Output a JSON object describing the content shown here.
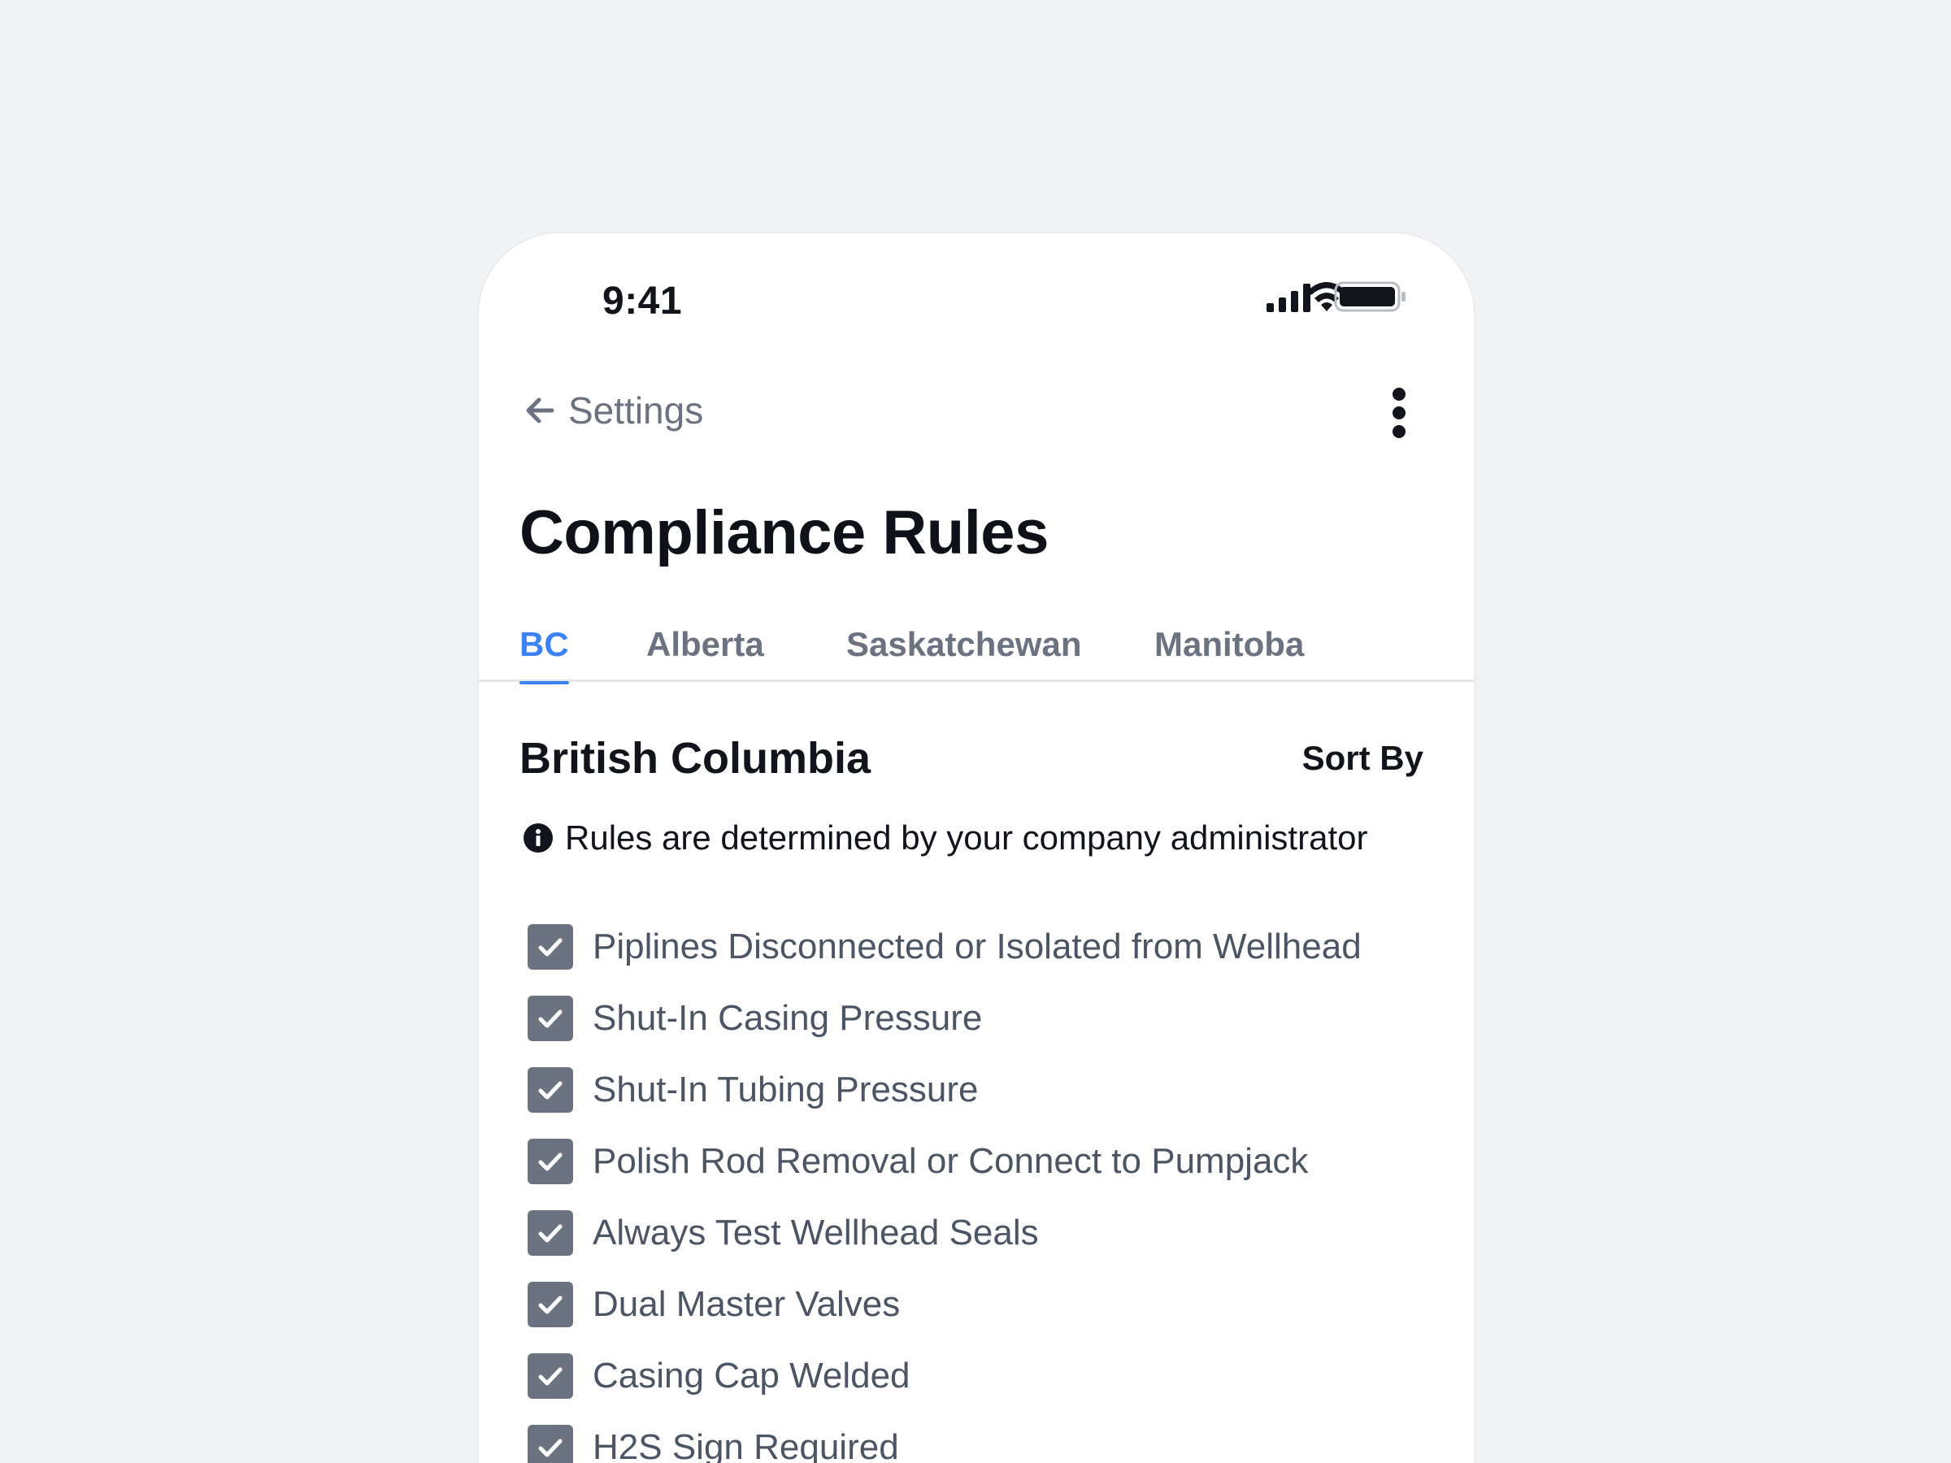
{
  "status_bar": {
    "time": "9:41",
    "icons": [
      "signal-icon",
      "wifi-icon",
      "battery-icon"
    ]
  },
  "nav": {
    "back_label": "Settings",
    "back_icon": "arrow-left-icon",
    "more_icon": "more-vertical-icon"
  },
  "page": {
    "title": "Compliance Rules"
  },
  "tabs": [
    {
      "label": "BC",
      "active": true
    },
    {
      "label": "Alberta",
      "active": false
    },
    {
      "label": "Saskatchewan",
      "active": false
    },
    {
      "label": "Manitoba",
      "active": false
    }
  ],
  "section": {
    "title": "British Columbia",
    "sort_label": "Sort By",
    "info_icon": "info-icon",
    "info_text": "Rules are determined by your company administrator"
  },
  "rules": [
    {
      "label": "Piplines Disconnected or Isolated from Wellhead",
      "checked": true
    },
    {
      "label": "Shut-In Casing Pressure",
      "checked": true
    },
    {
      "label": "Shut-In Tubing Pressure",
      "checked": true
    },
    {
      "label": "Polish Rod Removal or Connect to Pumpjack",
      "checked": true
    },
    {
      "label": "Always Test Wellhead Seals",
      "checked": true
    },
    {
      "label": "Dual Master Valves",
      "checked": true
    },
    {
      "label": "Casing Cap Welded",
      "checked": true
    },
    {
      "label": "H2S Sign Required",
      "checked": true
    }
  ],
  "colors": {
    "accent": "#3b82f6",
    "checkbox": "#6b7280",
    "background": "#f1f2f4"
  }
}
